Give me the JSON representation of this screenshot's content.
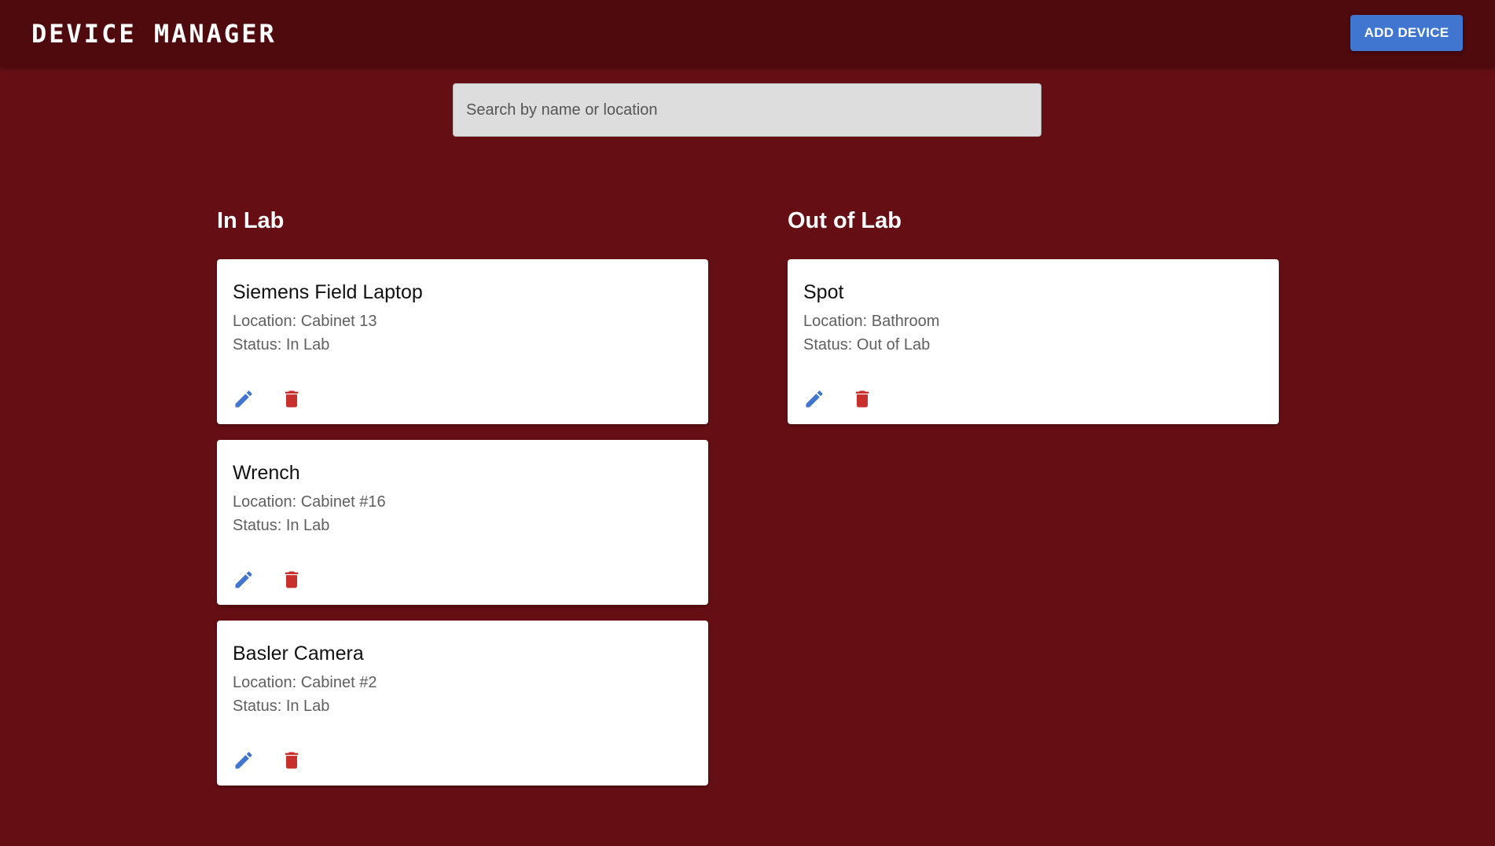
{
  "header": {
    "title": "Device Manager",
    "add_button_label": "ADD DEVICE"
  },
  "search": {
    "placeholder": "Search by name or location",
    "value": ""
  },
  "columns": {
    "in_lab": {
      "heading": "In Lab",
      "devices": [
        {
          "name": "Siemens Field Laptop",
          "location": "Location: Cabinet 13",
          "status": "Status: In Lab"
        },
        {
          "name": "Wrench",
          "location": "Location: Cabinet #16",
          "status": "Status: In Lab"
        },
        {
          "name": "Basler Camera",
          "location": "Location: Cabinet #2",
          "status": "Status: In Lab"
        }
      ]
    },
    "out_of_lab": {
      "heading": "Out of Lab",
      "devices": [
        {
          "name": "Spot",
          "location": "Location: Bathroom",
          "status": "Status: Out of Lab"
        }
      ]
    }
  },
  "icons": {
    "edit": "pencil-icon",
    "delete": "trash-icon"
  },
  "colors": {
    "background": "#650f14",
    "header": "#4f0a0e",
    "primary": "#4076cf",
    "danger": "#c8302e",
    "card": "#ffffff"
  }
}
